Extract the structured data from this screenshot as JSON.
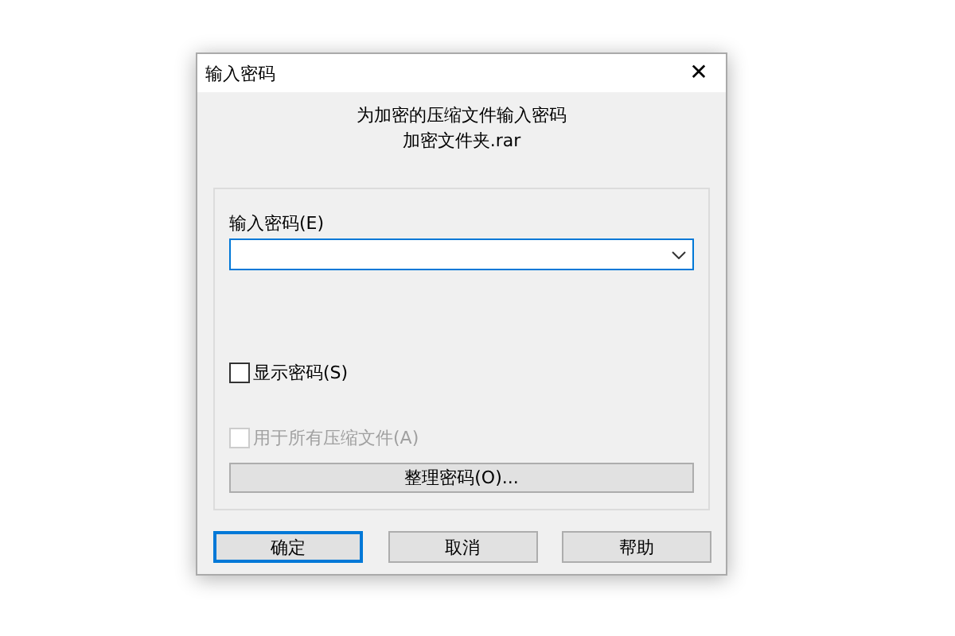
{
  "window": {
    "title": "输入密码",
    "close": "✕"
  },
  "header": {
    "line1": "为加密的压缩文件输入密码",
    "line2": "加密文件夹.rar"
  },
  "password": {
    "label": "输入密码(E)"
  },
  "checkboxes": [
    {
      "label": "显示密码(S)",
      "checked": false,
      "disabled": false
    },
    {
      "label": "用于所有压缩文件(A)",
      "checked": false,
      "disabled": true
    }
  ],
  "organize_button": "整理密码(O)...",
  "buttons": [
    {
      "label": "确定",
      "default": true
    },
    {
      "label": "取消",
      "default": false
    },
    {
      "label": "帮助",
      "default": false
    }
  ]
}
